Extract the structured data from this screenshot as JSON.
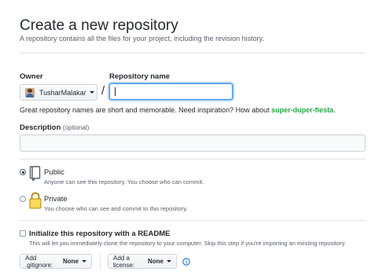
{
  "header": {
    "title": "Create a new repository",
    "subtitle": "A repository contains all the files for your project, including the revision history."
  },
  "owner": {
    "label": "Owner",
    "name": "TusharMalakar"
  },
  "repo_name": {
    "label": "Repository name",
    "value": ""
  },
  "separator": "/",
  "hint": {
    "text": "Great repository names are short and memorable. Need inspiration? How about ",
    "suggestion": "super-duper-fiesta",
    "end": "."
  },
  "description": {
    "label": "Description",
    "optional": "(optional)",
    "value": ""
  },
  "visibility": {
    "public": {
      "title": "Public",
      "desc": "Anyone can see this repository. You choose who can commit.",
      "selected": true
    },
    "private": {
      "title": "Private",
      "desc": "You choose who can see and commit to this repository.",
      "selected": false
    }
  },
  "readme": {
    "title": "Initialize this repository with a README",
    "desc": "This will let you immediately clone the repository to your computer. Skip this step if you’re importing an existing repository.",
    "checked": false
  },
  "gitignore": {
    "label": "Add .gitignore:",
    "value": "None"
  },
  "license": {
    "label": "Add a license:",
    "value": "None"
  },
  "icons": {
    "public": "repo-icon",
    "private": "lock-icon",
    "info": "info-icon",
    "caret": "caret-down-icon"
  },
  "colors": {
    "accent_blue": "#0366d6",
    "suggestion_green": "#28a745",
    "lock_gold": "#dbab09"
  }
}
